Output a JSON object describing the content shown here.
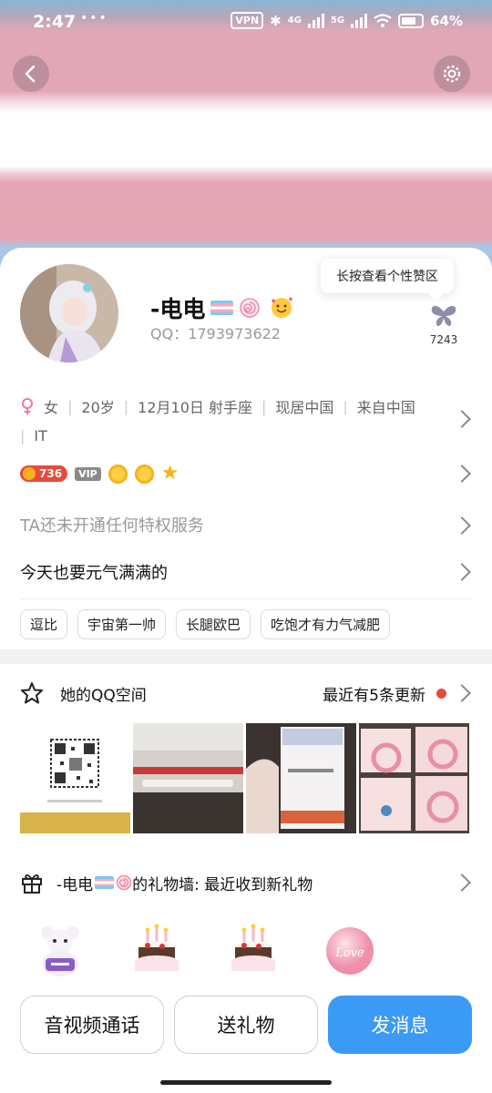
{
  "status_bar": {
    "time": "2:47",
    "dots": "•••",
    "vpn": "VPN",
    "net1": "4G",
    "net2": "5G",
    "battery": "64%"
  },
  "icons": {
    "back": "chevron-left-icon",
    "settings": "gear-icon",
    "gender": "female-icon",
    "space": "star-outline-icon",
    "gift": "gift-icon"
  },
  "profile": {
    "name": "-电电",
    "qq_label": "QQ：1793973622",
    "tooltip": "长按查看个性赞区",
    "likes": "7243"
  },
  "info": {
    "items": [
      "女",
      "20岁",
      "12月10日  射手座",
      "现居中国",
      "来自中国"
    ],
    "line2": "IT"
  },
  "level": {
    "badge": "736",
    "vip": "VIP"
  },
  "privilege_text": "TA还未开通任何特权服务",
  "signature": "今天也要元气满满的",
  "tags": [
    "逗比",
    "宇宙第一帅",
    "长腿欧巴",
    "吃饱才有力气减肥"
  ],
  "space": {
    "title": "她的QQ空间",
    "update": "最近有5条更新"
  },
  "gift_wall": {
    "prefix": "-电电",
    "suffix": "的礼物墙: 最近收到新礼物",
    "gift3_text": "Love"
  },
  "buttons": {
    "call": "音视频通话",
    "gift": "送礼物",
    "message": "发消息"
  },
  "colors": {
    "accent": "#3b9af5",
    "level_badge": "#e84a3c",
    "update_dot": "#e84a3c",
    "trans_pink": "#e3a6b5",
    "trans_blue": "#9ec6ea"
  }
}
